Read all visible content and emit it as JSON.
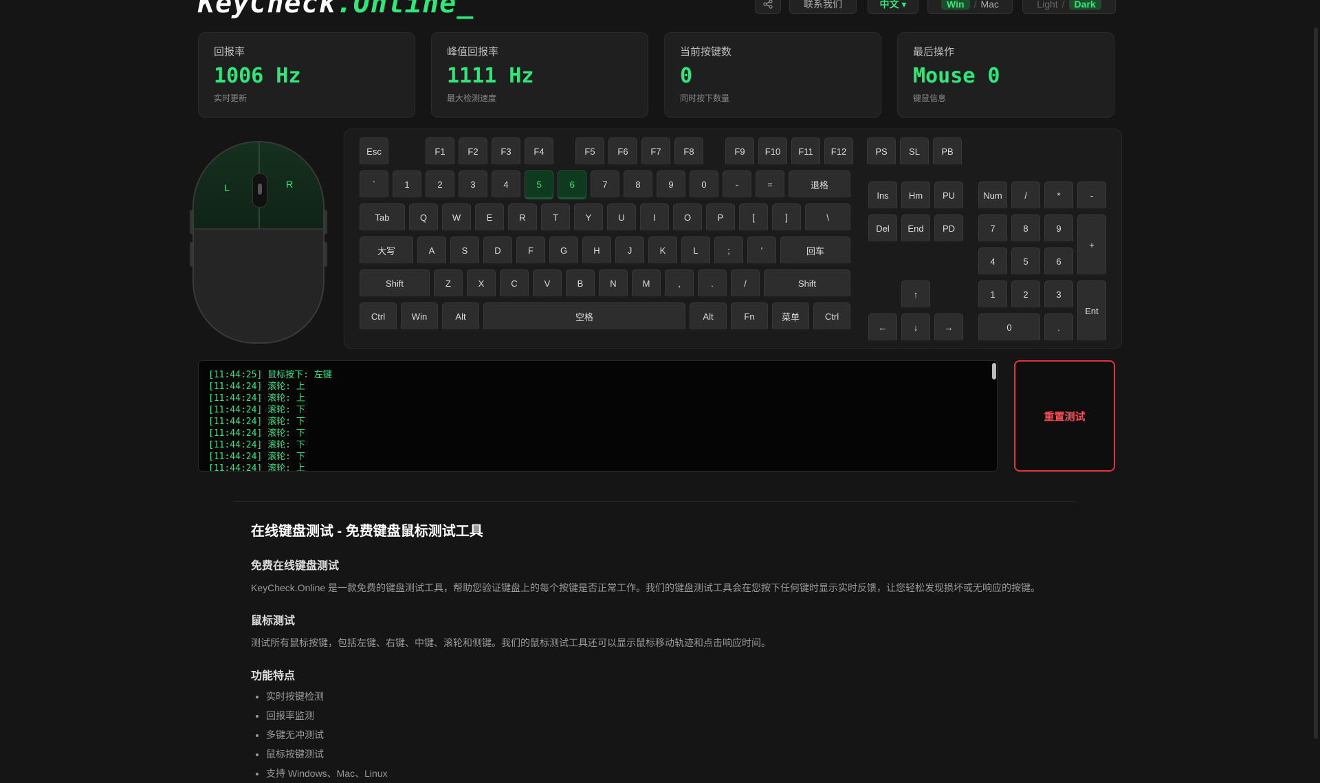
{
  "header": {
    "logo_main": "KeyCheck",
    "logo_accent": ".Online_",
    "share_icon": "share-icon",
    "contact_label": "联系我们",
    "lang_label": "中文 ▾",
    "os_win": "Win",
    "os_mac": "Mac",
    "os_sep": "/",
    "theme_light": "Light",
    "theme_dark": "Dark"
  },
  "stats": [
    {
      "title": "回报率",
      "value": "1006 Hz",
      "sub": "实时更新"
    },
    {
      "title": "峰值回报率",
      "value": "1111 Hz",
      "sub": "最大检测速度"
    },
    {
      "title": "当前按键数",
      "value": "0",
      "sub": "同时按下数量"
    },
    {
      "title": "最后操作",
      "value": "Mouse 0",
      "sub": "键鼠信息"
    }
  ],
  "mouse": {
    "left": "L",
    "right": "R"
  },
  "keys": {
    "esc": "Esc",
    "f1": "F1",
    "f2": "F2",
    "f3": "F3",
    "f4": "F4",
    "f5": "F5",
    "f6": "F6",
    "f7": "F7",
    "f8": "F8",
    "f9": "F9",
    "f10": "F10",
    "f11": "F11",
    "f12": "F12",
    "ps": "PS",
    "sl": "SL",
    "pb": "PB",
    "grave": "`",
    "d1": "1",
    "d2": "2",
    "d3": "3",
    "d4": "4",
    "d5": "5",
    "d6": "6",
    "d7": "7",
    "d8": "8",
    "d9": "9",
    "d0": "0",
    "minus": "-",
    "equal": "=",
    "backspace": "退格",
    "tab": "Tab",
    "q": "Q",
    "w": "W",
    "e": "E",
    "r": "R",
    "t": "T",
    "y": "Y",
    "u": "U",
    "i": "I",
    "o": "O",
    "p": "P",
    "lbr": "[",
    "rbr": "]",
    "bslash": "\\",
    "caps": "大写",
    "a": "A",
    "s": "S",
    "d": "D",
    "f": "F",
    "g": "G",
    "h": "H",
    "j": "J",
    "k": "K",
    "l": "L",
    "semi": ";",
    "quote": "'",
    "enter": "回车",
    "lshift": "Shift",
    "z": "Z",
    "x": "X",
    "c": "C",
    "v": "V",
    "b": "B",
    "n": "N",
    "m": "M",
    "comma": ",",
    "period": ".",
    "slash": "/",
    "rshift": "Shift",
    "lctrl": "Ctrl",
    "win": "Win",
    "lalt": "Alt",
    "space": "空格",
    "ralt": "Alt",
    "fn": "Fn",
    "menu": "菜单",
    "rctrl": "Ctrl",
    "ins": "Ins",
    "hm": "Hm",
    "pu": "PU",
    "del": "Del",
    "end": "End",
    "pd": "PD",
    "up": "↑",
    "left": "←",
    "down": "↓",
    "right": "→",
    "num": "Num",
    "ndiv": "/",
    "nmul": "*",
    "nsub": "-",
    "n7": "7",
    "n8": "8",
    "n9": "9",
    "nadd": "+",
    "n4": "4",
    "n5": "5",
    "n6": "6",
    "n1": "1",
    "n2": "2",
    "n3": "3",
    "nent": "Ent",
    "n0": "0",
    "ndot": "."
  },
  "active_keys": [
    "d5",
    "d6"
  ],
  "log": [
    "[11:44:25] 鼠标按下: 左键",
    "[11:44:24] 滚轮: 上",
    "[11:44:24] 滚轮: 上",
    "[11:44:24] 滚轮: 下",
    "[11:44:24] 滚轮: 下",
    "[11:44:24] 滚轮: 下",
    "[11:44:24] 滚轮: 下",
    "[11:44:24] 滚轮: 下",
    "[11:44:24] 滚轮: 上"
  ],
  "reset_label": "重置测试",
  "article": {
    "title": "在线键盘测试 - 免费键盘鼠标测试工具",
    "h_free": "免费在线键盘测试",
    "p_free": "KeyCheck.Online 是一款免费的键盘测试工具，帮助您验证键盘上的每个按键是否正常工作。我们的键盘测试工具会在您按下任何键时显示实时反馈，让您轻松发现损坏或无响应的按键。",
    "h_mouse": "鼠标测试",
    "p_mouse": "测试所有鼠标按键，包括左键、右键、中键、滚轮和侧键。我们的鼠标测试工具还可以显示鼠标移动轨迹和点击响应时间。",
    "h_features": "功能特点",
    "features": [
      "实时按键检测",
      "回报率监测",
      "多键无冲测试",
      "鼠标按键测试",
      "支持 Windows、Mac、Linux"
    ]
  }
}
